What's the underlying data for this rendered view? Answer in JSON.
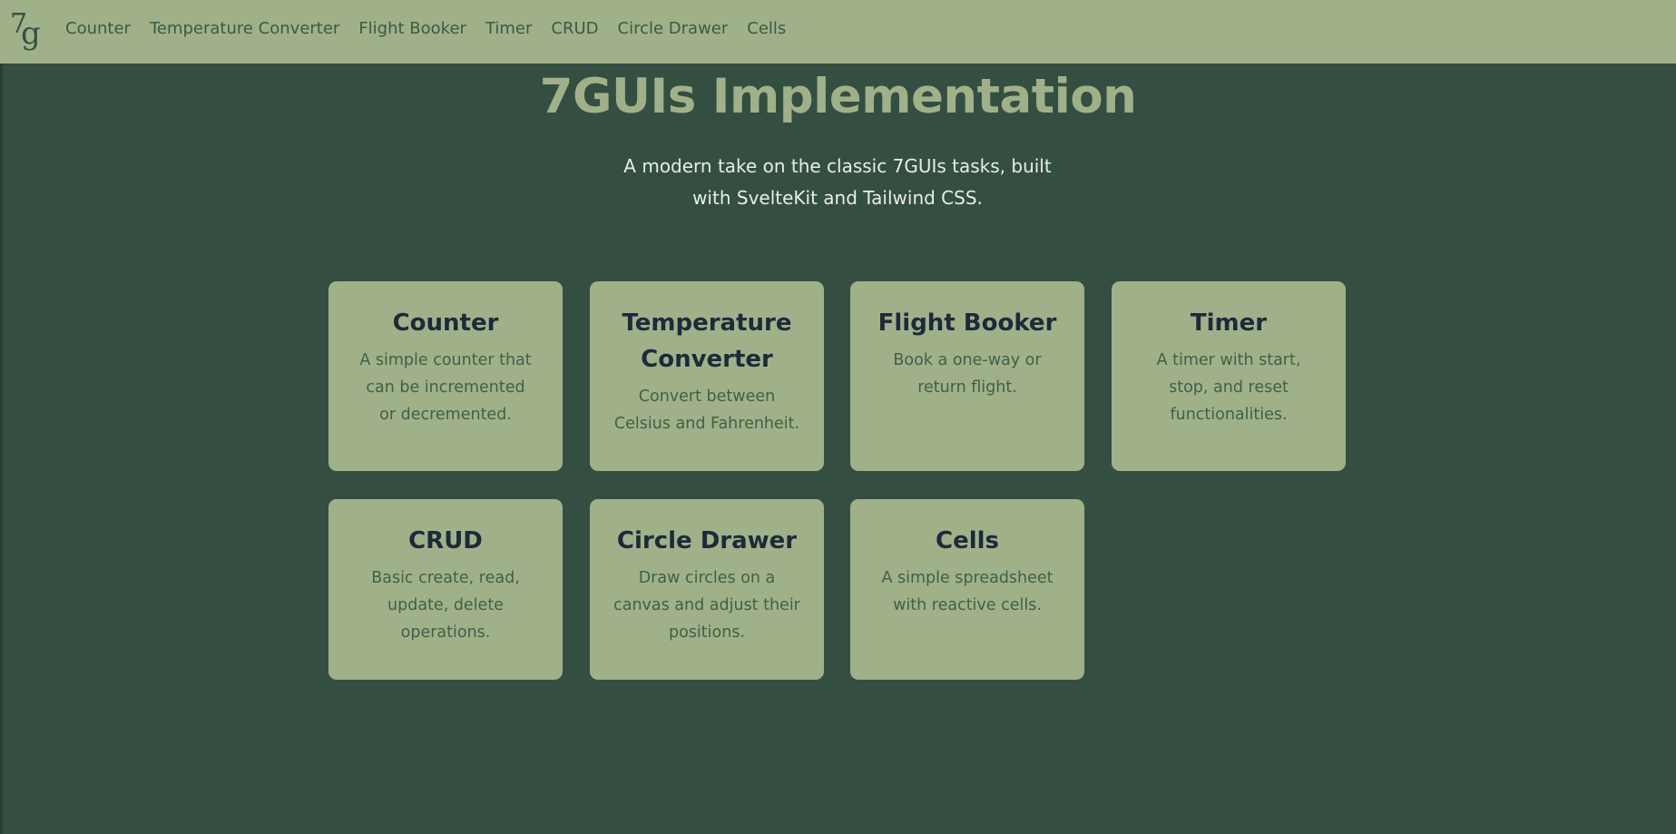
{
  "nav": {
    "logo_text_seven": "7",
    "logo_text_g": "g",
    "links": [
      "Counter",
      "Temperature Converter",
      "Flight Booker",
      "Timer",
      "CRUD",
      "Circle Drawer",
      "Cells"
    ]
  },
  "hero": {
    "title": "7GUIs Implementation",
    "subtitle": "A modern take on the classic 7GUIs tasks, built with SvelteKit and Tailwind CSS."
  },
  "cards": [
    {
      "title": "Counter",
      "description": "A simple counter that can be incremented or decremented."
    },
    {
      "title": "Temperature Converter",
      "description": "Convert between Celsius and Fahrenheit."
    },
    {
      "title": "Flight Booker",
      "description": "Book a one-way or return flight."
    },
    {
      "title": "Timer",
      "description": "A timer with start, stop, and reset functionalities."
    },
    {
      "title": "CRUD",
      "description": "Basic create, read, update, delete operations."
    },
    {
      "title": "Circle Drawer",
      "description": "Draw circles on a canvas and adjust their positions."
    },
    {
      "title": "Cells",
      "description": "A simple spreadsheet with reactive cells."
    }
  ],
  "colors": {
    "background": "#344f42",
    "navbar": "#a0b18a",
    "card": "#a0b18a",
    "title_accent": "#a0b18a",
    "card_title": "#1e2a3a",
    "card_text": "#3f6048"
  }
}
